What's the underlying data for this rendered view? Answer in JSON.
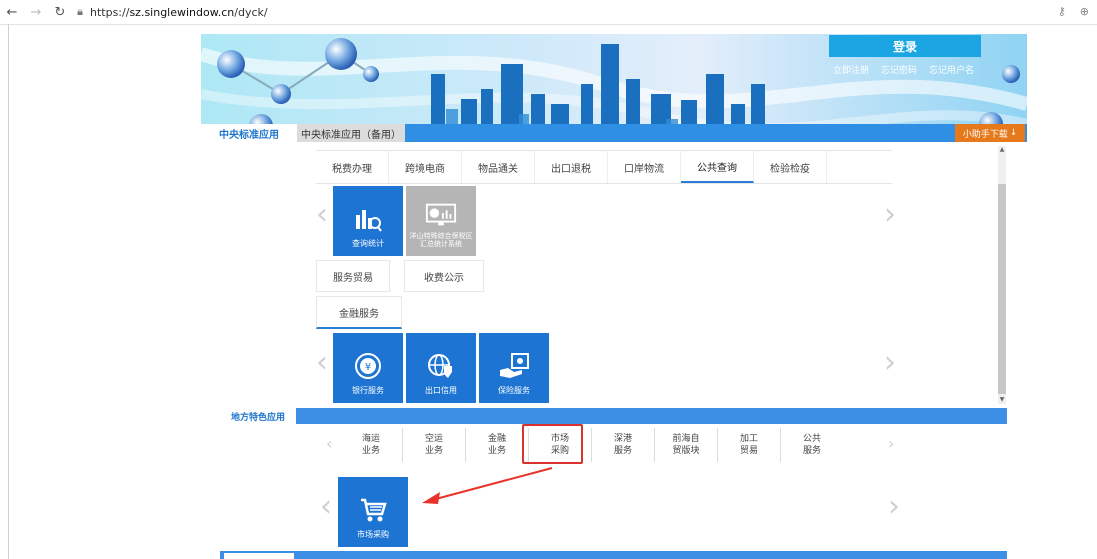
{
  "browser": {
    "url_prefix": "https://",
    "url_host": "sz.singlewindow.cn",
    "url_path": "/dyck/"
  },
  "header": {
    "login_label": "登录",
    "links": [
      "立即注册",
      "忘记密码",
      "忘记用户名"
    ]
  },
  "top_tabs": {
    "active": "中央标准应用",
    "secondary": "中央标准应用（备用）",
    "helper": "小助手下载"
  },
  "menu": {
    "items": [
      "税费办理",
      "跨境电商",
      "物品通关",
      "出口退税",
      "口岸物流",
      "公共查询",
      "检验检疫"
    ],
    "active_index": 5
  },
  "query_tiles": [
    {
      "label": "查询统计",
      "icon": "bar-chart-magnifier-icon",
      "color": "blue"
    },
    {
      "label": "洋山特殊综合保税区汇总统计系统",
      "icon": "monitor-chart-icon",
      "color": "grey"
    }
  ],
  "sub_tabs": [
    "服务贸易",
    "收费公示"
  ],
  "finance_tab": "金融服务",
  "finance_tiles": [
    {
      "label": "银行服务",
      "icon": "yuan-coin-icon"
    },
    {
      "label": "出口信用",
      "icon": "globe-shield-icon"
    },
    {
      "label": "保险服务",
      "icon": "safe-hand-icon"
    }
  ],
  "local": {
    "tab": "地方特色应用",
    "items": [
      "海运\n业务",
      "空运\n业务",
      "金融\n业务",
      "市场\n采购",
      "深港\n服务",
      "前海自\n贸版块",
      "加工\n贸易",
      "公共\n服务"
    ],
    "highlighted_index": 3,
    "tile": {
      "label": "市场采购",
      "icon": "shopping-cart-icon"
    }
  },
  "colors": {
    "blue": "#1d74d2",
    "bar": "#3d8fe6",
    "highlight": "#d9322c",
    "arrow": "#e8322a"
  }
}
